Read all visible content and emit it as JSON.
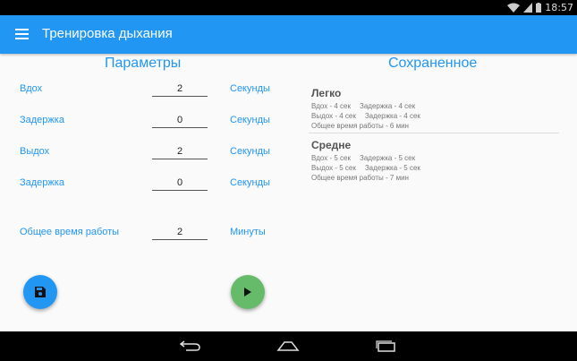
{
  "status_bar": {
    "time": "18:57"
  },
  "app_bar": {
    "title": "Тренировка дыхания"
  },
  "parameters": {
    "title": "Параметры",
    "rows": [
      {
        "label": "Вдох",
        "value": "2",
        "unit": "Секунды"
      },
      {
        "label": "Задержка",
        "value": "0",
        "unit": "Секунды"
      },
      {
        "label": "Выдох",
        "value": "2",
        "unit": "Секунды"
      },
      {
        "label": "Задержка",
        "value": "0",
        "unit": "Секунды"
      }
    ],
    "total": {
      "label": "Общее время работы",
      "value": "2",
      "unit": "Минуты"
    }
  },
  "saved": {
    "title": "Сохраненное",
    "presets": [
      {
        "name": "Легко",
        "inhale": "Вдох - 4 сек",
        "hold1": "Задержка - 4 сек",
        "exhale": "Выдох - 4 сек",
        "hold2": "Задержка - 4 сек",
        "total": "Общее время работы - 6 мин"
      },
      {
        "name": "Средне",
        "inhale": "Вдох - 5 сек",
        "hold1": "Задержка - 5 сек",
        "exhale": "Выдох - 5 сек",
        "hold2": "Задержка - 5 сек",
        "total": "Общее время работы - 7 мин"
      }
    ]
  },
  "colors": {
    "primary": "#2196f3",
    "play": "#66bb6a"
  },
  "icons": {
    "save": "floppy-disk-icon",
    "play": "play-icon",
    "menu": "hamburger-icon"
  }
}
